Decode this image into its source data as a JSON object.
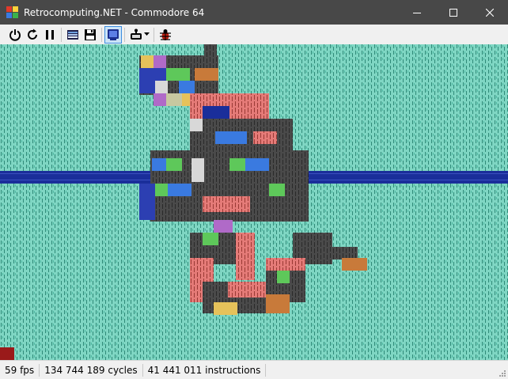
{
  "window": {
    "title": "Retrocomputing.NET - Commodore 64",
    "app_icon": "retro-app-icon",
    "controls": [
      "minimize-icon",
      "maximize-icon",
      "close-icon"
    ]
  },
  "toolbar": {
    "buttons": [
      {
        "name": "power-icon"
      },
      {
        "name": "reset-icon"
      },
      {
        "name": "pause-icon"
      },
      {
        "name": "tape-icon"
      },
      {
        "name": "floppy-disk-icon"
      },
      {
        "name": "display-icon",
        "active": true
      },
      {
        "name": "joystick-icon",
        "has_dropdown": true
      },
      {
        "name": "debugger-bug-icon"
      }
    ]
  },
  "screen": {
    "background_color": "#7fd6c3",
    "pattern_color": "#3a9a88",
    "border_band_color": "#1a2e9a"
  },
  "status": {
    "fps": "59 fps",
    "cycles": "134 744 189 cycles",
    "instructions": "41 441 011 instructions"
  }
}
